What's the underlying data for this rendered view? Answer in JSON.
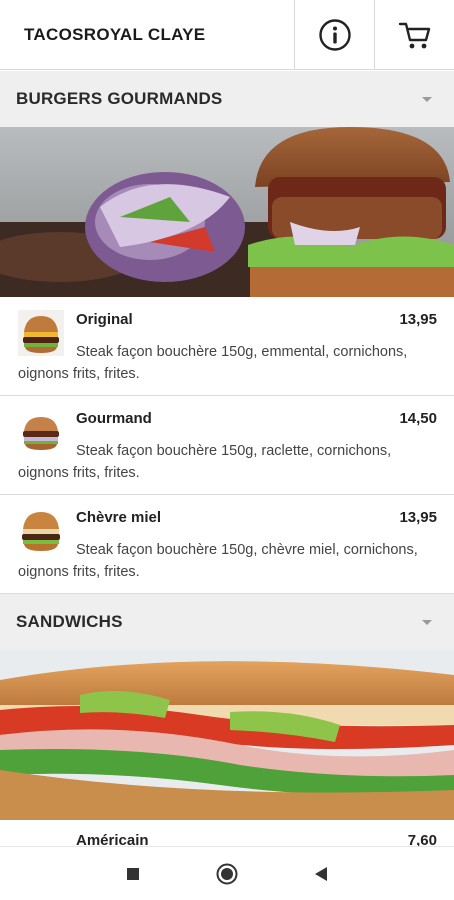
{
  "app": {
    "title": "TACOSROYAL CLAYE",
    "info_icon": "info-circle-icon",
    "cart_icon": "cart-icon"
  },
  "sections": [
    {
      "label": "BURGERS GOURMANDS",
      "banner": "burger-banner-image",
      "items": [
        {
          "name": "Original",
          "price": "13,95",
          "description": "Steak façon bouchère 150g, emmental, cornichons, oignons frits, frites."
        },
        {
          "name": "Gourmand",
          "price": "14,50",
          "description": "Steak façon bouchère 150g, raclette, cornichons, oignons frits, frites."
        },
        {
          "name": "Chèvre miel",
          "price": "13,95",
          "description": "Steak façon bouchère 150g, chèvre miel, cornichons, oignons frits, frites."
        }
      ]
    },
    {
      "label": "SANDWICHS",
      "banner": "sandwich-banner-image",
      "items": [
        {
          "name": "Américain",
          "price": "7,60"
        }
      ]
    }
  ],
  "navigation": {
    "recents_icon": "square-icon",
    "home_icon": "circle-home-icon",
    "back_icon": "triangle-back-icon"
  }
}
